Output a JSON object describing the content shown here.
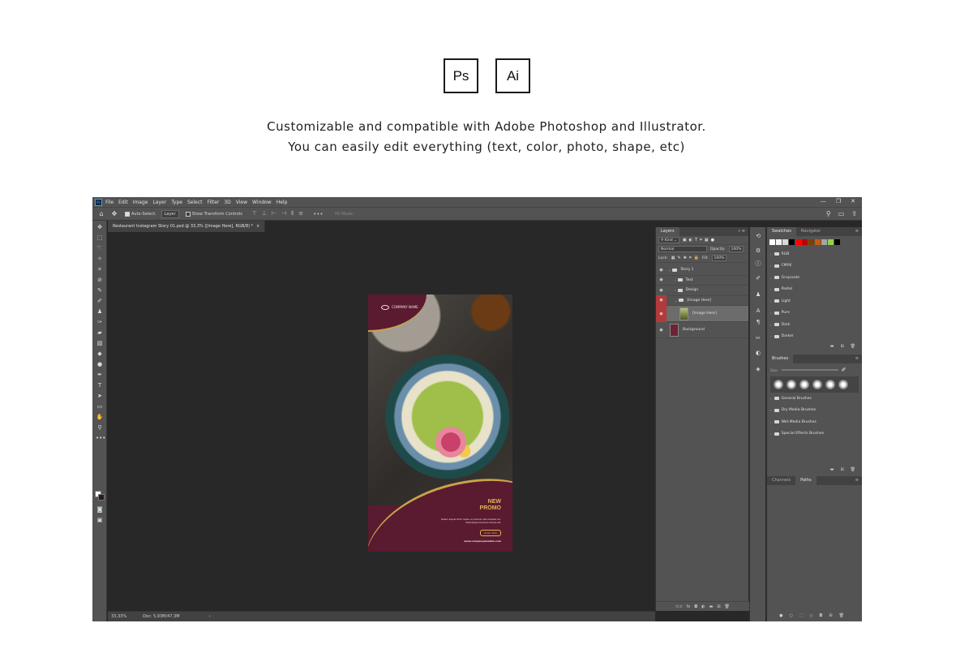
{
  "header": {
    "badges": [
      "Ps",
      "Ai"
    ],
    "line1": "Customizable and compatible with Adobe Photoshop and Illustrator.",
    "line2": "You can easily edit everything (text, color, photo, shape, etc)"
  },
  "photoshop": {
    "logo": "Ps",
    "menu": [
      "File",
      "Edit",
      "Image",
      "Layer",
      "Type",
      "Select",
      "Filter",
      "3D",
      "View",
      "Window",
      "Help"
    ],
    "window_controls": [
      "—",
      "❐",
      "✕"
    ],
    "options": {
      "auto_select_label": "Auto-Select:",
      "auto_select_target": "Layer",
      "transform_label": "Show Transform Controls",
      "mode_3d": "3D Mode:"
    },
    "document_tab": "Restaurant Instagram Story 01.psd @ 33,3% ([Image Here], RGB/8) *",
    "document_tab_close": "×",
    "status": {
      "zoom": "33,33%",
      "doc": "Doc: 5,93M/47,3M",
      "arrow": "›"
    },
    "story": {
      "logo_text": "COMPANY NAME",
      "promo_line1": "NEW",
      "promo_line2": "PROMO",
      "body": "Nullam aliquet tortor metus, ac pulvinar velit molestie nec. Pellentesque faucibus ultricies elit.",
      "cta": "Order Now",
      "website": "www.companywebsite.com"
    },
    "layers_panel": {
      "tab": "Layers",
      "kind_label": "Kind",
      "blend_mode": "Normal",
      "opacity_label": "Opacity:",
      "opacity_value": "100%",
      "lock_label": "Lock:",
      "fill_label": "Fill:",
      "fill_value": "100%",
      "layers": [
        {
          "name": "Story 1",
          "type": "group"
        },
        {
          "name": "Text",
          "type": "group"
        },
        {
          "name": "Design",
          "type": "group"
        },
        {
          "name": "[Image Here]",
          "type": "group"
        },
        {
          "name": "[Image Here]",
          "type": "image"
        },
        {
          "name": "Background",
          "type": "fill"
        }
      ]
    },
    "swatches_panel": {
      "tabs": [
        "Swatches",
        "Navigator"
      ],
      "colors": [
        "#ffffff",
        "#f2f2f2",
        "#d9d9d9",
        "#000000",
        "#ff0000",
        "#c00000",
        "#7f3f00",
        "#c55a11",
        "#a5a5a5",
        "#92d050",
        "#000000"
      ],
      "groups": [
        "RGB",
        "CMYK",
        "Grayscale",
        "Pastel",
        "Light",
        "Pure",
        "Dark",
        "Darker"
      ]
    },
    "brushes_panel": {
      "tab": "Brushes",
      "size_label": "Size:",
      "groups": [
        "General Brushes",
        "Dry Media Brushes",
        "Wet Media Brushes",
        "Special Effects Brushes"
      ]
    },
    "paths_panel": {
      "tabs": [
        "Channels",
        "Paths"
      ]
    }
  }
}
